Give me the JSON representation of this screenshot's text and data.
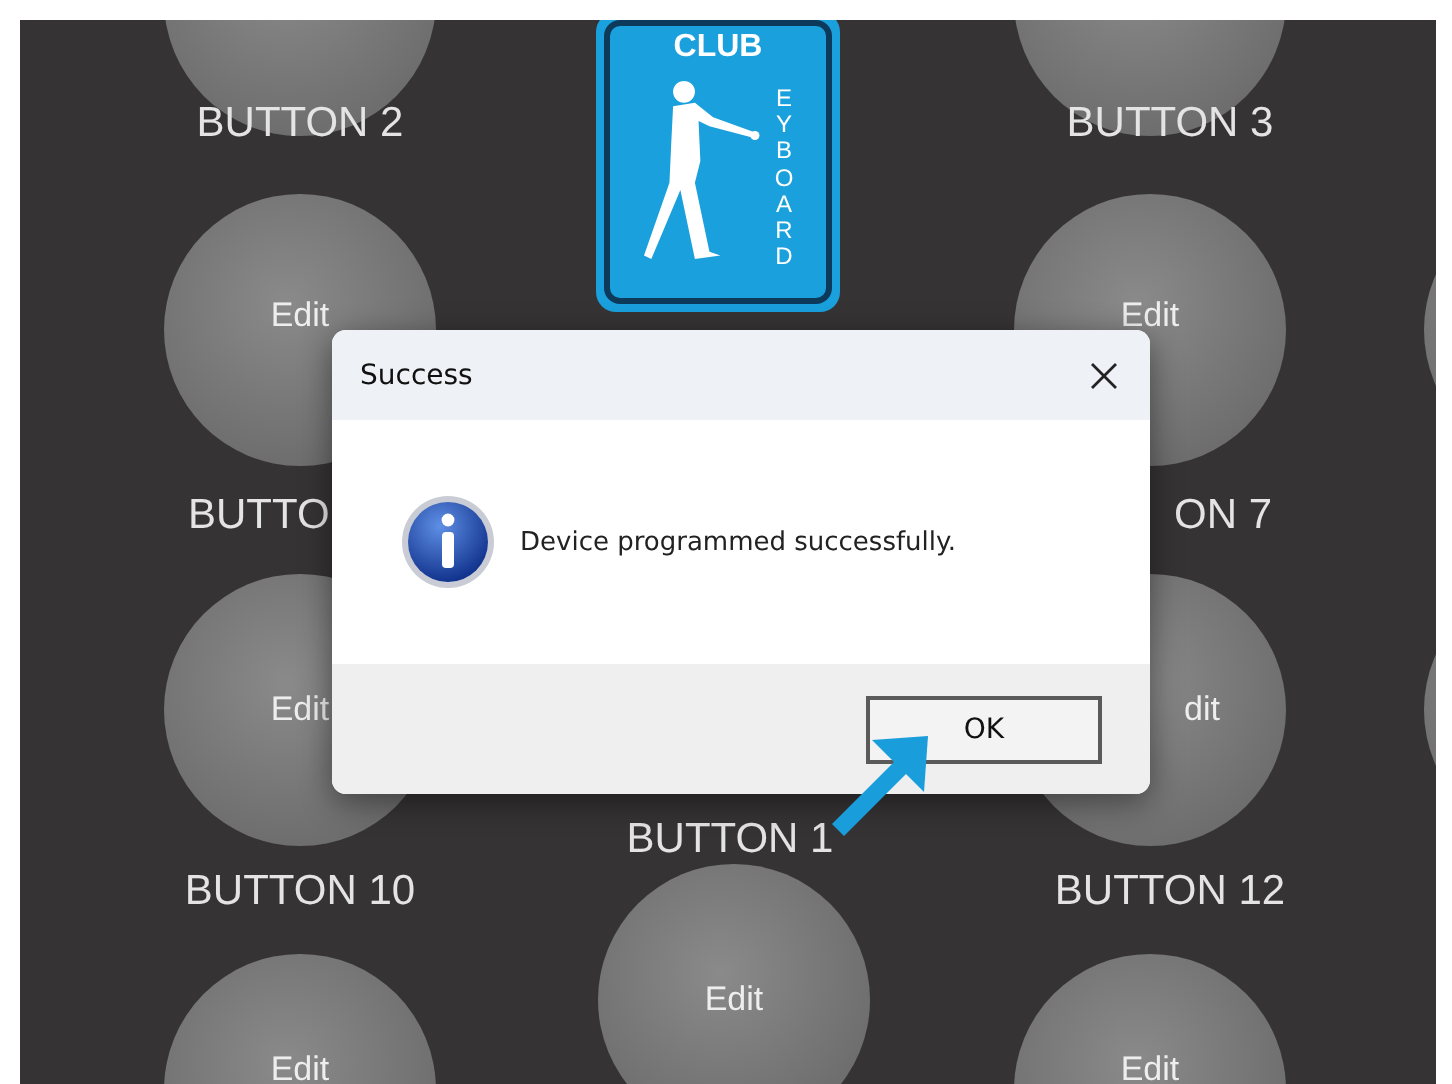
{
  "logo": {
    "top_text": "CLUB",
    "side_text": "EYBOARD"
  },
  "button_labels": [
    "BUTTON 2",
    "BUTTON 3",
    "BUTTO",
    "ON 7",
    "BUTTON 1",
    "BUTTON 10",
    "BUTTON 12"
  ],
  "edit_buttons": [
    "Edit",
    "Edit",
    "Edit",
    "dit",
    "Edit",
    "Edit",
    "Edit"
  ],
  "dialog": {
    "title": "Success",
    "message": "Device programmed successfully.",
    "buttons": [
      "OK"
    ]
  }
}
